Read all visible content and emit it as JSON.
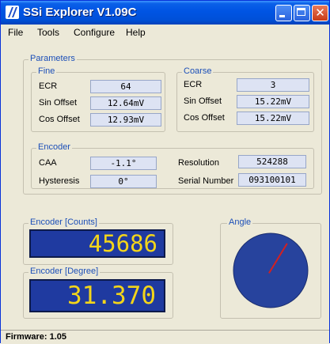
{
  "window": {
    "title": "SSi Explorer V1.09C"
  },
  "menu": {
    "items": [
      "File",
      "Tools",
      "Configure",
      "Help"
    ]
  },
  "parameters": {
    "label": "Parameters",
    "fine": {
      "label": "Fine",
      "ecr_label": "ECR",
      "ecr_value": "64",
      "sin_label": "Sin Offset",
      "sin_value": "12.64mV",
      "cos_label": "Cos Offset",
      "cos_value": "12.93mV"
    },
    "coarse": {
      "label": "Coarse",
      "ecr_label": "ECR",
      "ecr_value": "3",
      "sin_label": "Sin Offset",
      "sin_value": "15.22mV",
      "cos_label": "Cos Offset",
      "cos_value": "15.22mV"
    },
    "encoder": {
      "label": "Encoder",
      "caa_label": "CAA",
      "caa_value": "-1.1°",
      "hyst_label": "Hysteresis",
      "hyst_value": "0°",
      "res_label": "Resolution",
      "res_value": "524288",
      "serial_label": "Serial Number",
      "serial_value": "093100101"
    }
  },
  "encoder_counts": {
    "label": "Encoder [Counts]",
    "value": "45686"
  },
  "encoder_degree": {
    "label": "Encoder [Degree]",
    "value": "31.370"
  },
  "angle": {
    "label": "Angle",
    "degrees": 31.37,
    "dial_color": "#27439d",
    "needle_color": "#d42020"
  },
  "status": {
    "firmware": "Firmware: 1.05"
  },
  "colors": {
    "titlebar": "#0054e3",
    "lcd_background": "#1f3aa0",
    "lcd_digits": "#f3d51a",
    "group_label": "#1c4fb8"
  }
}
